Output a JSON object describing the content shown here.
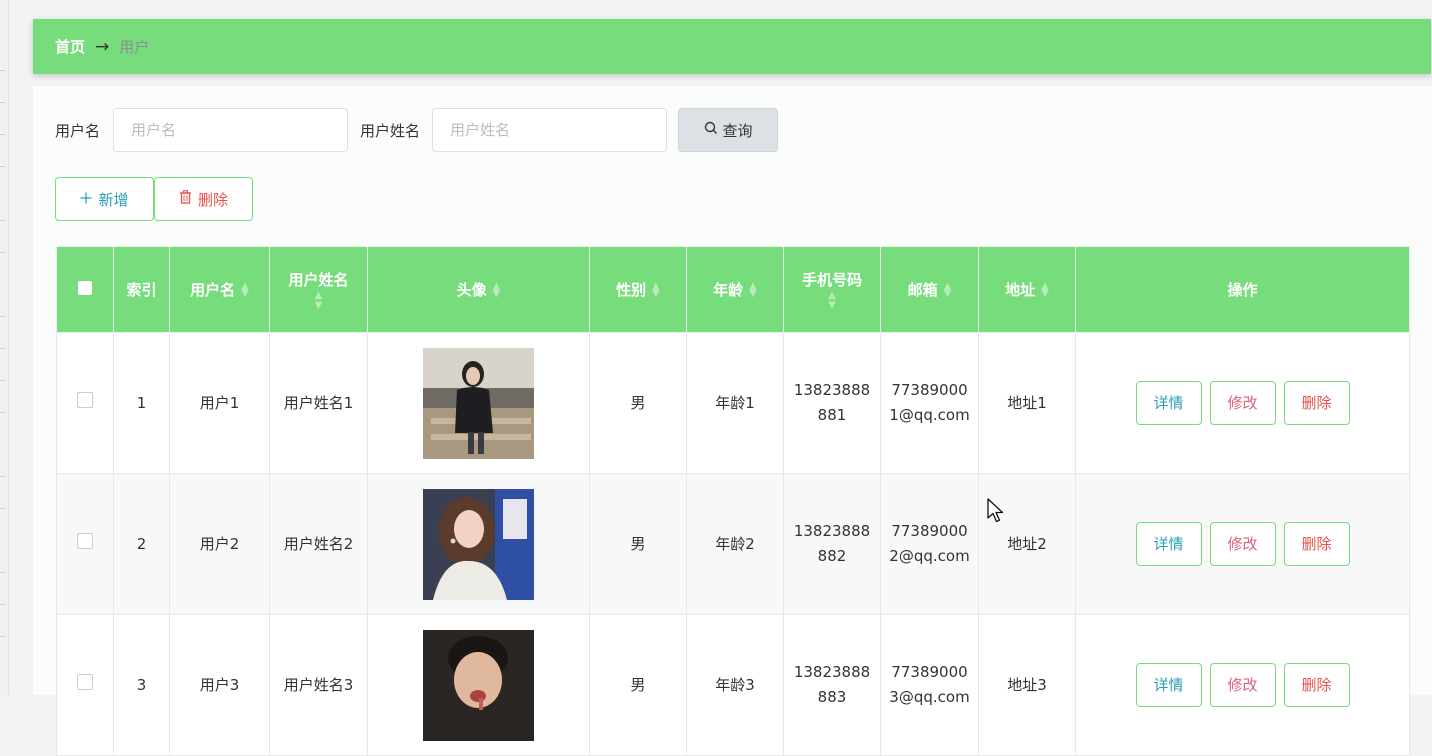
{
  "breadcrumb": {
    "home": "首页",
    "arrow": "→",
    "current": "用户"
  },
  "search": {
    "username_label": "用户名",
    "username_placeholder": "用户名",
    "realname_label": "用户姓名",
    "realname_placeholder": "用户姓名",
    "query_label": "查询",
    "query_icon": "search-icon"
  },
  "actions": {
    "add_label": "新增",
    "add_icon": "plus-icon",
    "delete_label": "删除",
    "delete_icon": "trash-icon"
  },
  "table": {
    "headers": {
      "index": "索引",
      "username": "用户名",
      "realname": "用户姓名",
      "avatar": "头像",
      "gender": "性别",
      "age": "年龄",
      "phone": "手机号码",
      "email": "邮箱",
      "address": "地址",
      "operations": "操作"
    },
    "rows": [
      {
        "index": "1",
        "username": "用户1",
        "realname": "用户姓名1",
        "gender": "男",
        "age": "年龄1",
        "phone": "13823888881",
        "email": "773890001@qq.com",
        "address": "地址1"
      },
      {
        "index": "2",
        "username": "用户2",
        "realname": "用户姓名2",
        "gender": "男",
        "age": "年龄2",
        "phone": "13823888882",
        "email": "773890002@qq.com",
        "address": "地址2"
      },
      {
        "index": "3",
        "username": "用户3",
        "realname": "用户姓名3",
        "gender": "男",
        "age": "年龄3",
        "phone": "13823888883",
        "email": "773890003@qq.com",
        "address": "地址3"
      }
    ],
    "row_buttons": {
      "detail": "详情",
      "edit": "修改",
      "delete": "删除"
    }
  },
  "colors": {
    "accent_green": "#77dc7b",
    "info_teal": "#2aa0b5",
    "danger_red": "#e8524a",
    "edit_pink": "#e0607a"
  }
}
